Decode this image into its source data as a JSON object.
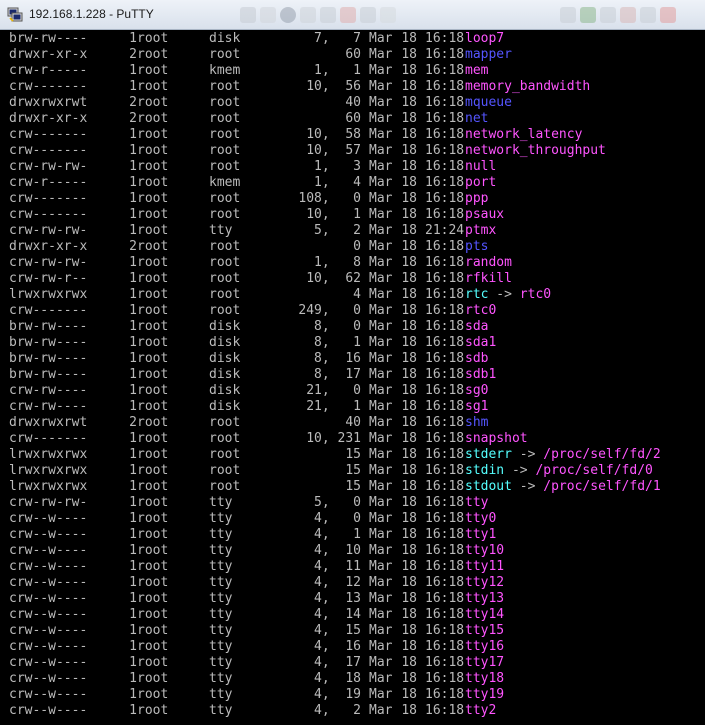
{
  "window": {
    "title": "192.168.1.228 - PuTTY"
  },
  "colors": {
    "background": "#000000",
    "text": "#bbbbbb",
    "directory": "#5555ff",
    "device": "#ff55ff",
    "symlink": "#55ffff"
  },
  "rows": [
    {
      "perm": "brw-rw----",
      "links": "1",
      "owner": "root",
      "group": "disk",
      "size": "7,   7",
      "mon": "Mar",
      "day": "18",
      "time": "16:18",
      "name": "loop7",
      "type": "char",
      "target": "",
      "target_type": ""
    },
    {
      "perm": "drwxr-xr-x",
      "links": "2",
      "owner": "root",
      "group": "root",
      "size": "60",
      "mon": "Mar",
      "day": "18",
      "time": "16:18",
      "name": "mapper",
      "type": "dir",
      "target": "",
      "target_type": ""
    },
    {
      "perm": "crw-r-----",
      "links": "1",
      "owner": "root",
      "group": "kmem",
      "size": "1,   1",
      "mon": "Mar",
      "day": "18",
      "time": "16:18",
      "name": "mem",
      "type": "char",
      "target": "",
      "target_type": ""
    },
    {
      "perm": "crw-------",
      "links": "1",
      "owner": "root",
      "group": "root",
      "size": "10,  56",
      "mon": "Mar",
      "day": "18",
      "time": "16:18",
      "name": "memory_bandwidth",
      "type": "char",
      "target": "",
      "target_type": ""
    },
    {
      "perm": "drwxrwxrwt",
      "links": "2",
      "owner": "root",
      "group": "root",
      "size": "40",
      "mon": "Mar",
      "day": "18",
      "time": "16:18",
      "name": "mqueue",
      "type": "dir",
      "target": "",
      "target_type": ""
    },
    {
      "perm": "drwxr-xr-x",
      "links": "2",
      "owner": "root",
      "group": "root",
      "size": "60",
      "mon": "Mar",
      "day": "18",
      "time": "16:18",
      "name": "net",
      "type": "dir",
      "target": "",
      "target_type": ""
    },
    {
      "perm": "crw-------",
      "links": "1",
      "owner": "root",
      "group": "root",
      "size": "10,  58",
      "mon": "Mar",
      "day": "18",
      "time": "16:18",
      "name": "network_latency",
      "type": "char",
      "target": "",
      "target_type": ""
    },
    {
      "perm": "crw-------",
      "links": "1",
      "owner": "root",
      "group": "root",
      "size": "10,  57",
      "mon": "Mar",
      "day": "18",
      "time": "16:18",
      "name": "network_throughput",
      "type": "char",
      "target": "",
      "target_type": ""
    },
    {
      "perm": "crw-rw-rw-",
      "links": "1",
      "owner": "root",
      "group": "root",
      "size": "1,   3",
      "mon": "Mar",
      "day": "18",
      "time": "16:18",
      "name": "null",
      "type": "char",
      "target": "",
      "target_type": ""
    },
    {
      "perm": "crw-r-----",
      "links": "1",
      "owner": "root",
      "group": "kmem",
      "size": "1,   4",
      "mon": "Mar",
      "day": "18",
      "time": "16:18",
      "name": "port",
      "type": "char",
      "target": "",
      "target_type": ""
    },
    {
      "perm": "crw-------",
      "links": "1",
      "owner": "root",
      "group": "root",
      "size": "108,   0",
      "mon": "Mar",
      "day": "18",
      "time": "16:18",
      "name": "ppp",
      "type": "char",
      "target": "",
      "target_type": ""
    },
    {
      "perm": "crw-------",
      "links": "1",
      "owner": "root",
      "group": "root",
      "size": "10,   1",
      "mon": "Mar",
      "day": "18",
      "time": "16:18",
      "name": "psaux",
      "type": "char",
      "target": "",
      "target_type": ""
    },
    {
      "perm": "crw-rw-rw-",
      "links": "1",
      "owner": "root",
      "group": "tty",
      "size": "5,   2",
      "mon": "Mar",
      "day": "18",
      "time": "21:24",
      "name": "ptmx",
      "type": "char",
      "target": "",
      "target_type": ""
    },
    {
      "perm": "drwxr-xr-x",
      "links": "2",
      "owner": "root",
      "group": "root",
      "size": "0",
      "mon": "Mar",
      "day": "18",
      "time": "16:18",
      "name": "pts",
      "type": "dir",
      "target": "",
      "target_type": ""
    },
    {
      "perm": "crw-rw-rw-",
      "links": "1",
      "owner": "root",
      "group": "root",
      "size": "1,   8",
      "mon": "Mar",
      "day": "18",
      "time": "16:18",
      "name": "random",
      "type": "char",
      "target": "",
      "target_type": ""
    },
    {
      "perm": "crw-rw-r--",
      "links": "1",
      "owner": "root",
      "group": "root",
      "size": "10,  62",
      "mon": "Mar",
      "day": "18",
      "time": "16:18",
      "name": "rfkill",
      "type": "char",
      "target": "",
      "target_type": ""
    },
    {
      "perm": "lrwxrwxrwx",
      "links": "1",
      "owner": "root",
      "group": "root",
      "size": "4",
      "mon": "Mar",
      "day": "18",
      "time": "16:18",
      "name": "rtc",
      "type": "link",
      "target": "rtc0",
      "target_type": "char"
    },
    {
      "perm": "crw-------",
      "links": "1",
      "owner": "root",
      "group": "root",
      "size": "249,   0",
      "mon": "Mar",
      "day": "18",
      "time": "16:18",
      "name": "rtc0",
      "type": "char",
      "target": "",
      "target_type": ""
    },
    {
      "perm": "brw-rw----",
      "links": "1",
      "owner": "root",
      "group": "disk",
      "size": "8,   0",
      "mon": "Mar",
      "day": "18",
      "time": "16:18",
      "name": "sda",
      "type": "char",
      "target": "",
      "target_type": ""
    },
    {
      "perm": "brw-rw----",
      "links": "1",
      "owner": "root",
      "group": "disk",
      "size": "8,   1",
      "mon": "Mar",
      "day": "18",
      "time": "16:18",
      "name": "sda1",
      "type": "char",
      "target": "",
      "target_type": ""
    },
    {
      "perm": "brw-rw----",
      "links": "1",
      "owner": "root",
      "group": "disk",
      "size": "8,  16",
      "mon": "Mar",
      "day": "18",
      "time": "16:18",
      "name": "sdb",
      "type": "char",
      "target": "",
      "target_type": ""
    },
    {
      "perm": "brw-rw----",
      "links": "1",
      "owner": "root",
      "group": "disk",
      "size": "8,  17",
      "mon": "Mar",
      "day": "18",
      "time": "16:18",
      "name": "sdb1",
      "type": "char",
      "target": "",
      "target_type": ""
    },
    {
      "perm": "crw-rw----",
      "links": "1",
      "owner": "root",
      "group": "disk",
      "size": "21,   0",
      "mon": "Mar",
      "day": "18",
      "time": "16:18",
      "name": "sg0",
      "type": "char",
      "target": "",
      "target_type": ""
    },
    {
      "perm": "crw-rw----",
      "links": "1",
      "owner": "root",
      "group": "disk",
      "size": "21,   1",
      "mon": "Mar",
      "day": "18",
      "time": "16:18",
      "name": "sg1",
      "type": "char",
      "target": "",
      "target_type": ""
    },
    {
      "perm": "drwxrwxrwt",
      "links": "2",
      "owner": "root",
      "group": "root",
      "size": "40",
      "mon": "Mar",
      "day": "18",
      "time": "16:18",
      "name": "shm",
      "type": "dir",
      "target": "",
      "target_type": ""
    },
    {
      "perm": "crw-------",
      "links": "1",
      "owner": "root",
      "group": "root",
      "size": "10, 231",
      "mon": "Mar",
      "day": "18",
      "time": "16:18",
      "name": "snapshot",
      "type": "char",
      "target": "",
      "target_type": ""
    },
    {
      "perm": "lrwxrwxrwx",
      "links": "1",
      "owner": "root",
      "group": "root",
      "size": "15",
      "mon": "Mar",
      "day": "18",
      "time": "16:18",
      "name": "stderr",
      "type": "link",
      "target": "/proc/self/fd/2",
      "target_type": "char"
    },
    {
      "perm": "lrwxrwxrwx",
      "links": "1",
      "owner": "root",
      "group": "root",
      "size": "15",
      "mon": "Mar",
      "day": "18",
      "time": "16:18",
      "name": "stdin",
      "type": "link",
      "target": "/proc/self/fd/0",
      "target_type": "char"
    },
    {
      "perm": "lrwxrwxrwx",
      "links": "1",
      "owner": "root",
      "group": "root",
      "size": "15",
      "mon": "Mar",
      "day": "18",
      "time": "16:18",
      "name": "stdout",
      "type": "link",
      "target": "/proc/self/fd/1",
      "target_type": "char"
    },
    {
      "perm": "crw-rw-rw-",
      "links": "1",
      "owner": "root",
      "group": "tty",
      "size": "5,   0",
      "mon": "Mar",
      "day": "18",
      "time": "16:18",
      "name": "tty",
      "type": "char",
      "target": "",
      "target_type": ""
    },
    {
      "perm": "crw--w----",
      "links": "1",
      "owner": "root",
      "group": "tty",
      "size": "4,   0",
      "mon": "Mar",
      "day": "18",
      "time": "16:18",
      "name": "tty0",
      "type": "char",
      "target": "",
      "target_type": ""
    },
    {
      "perm": "crw--w----",
      "links": "1",
      "owner": "root",
      "group": "tty",
      "size": "4,   1",
      "mon": "Mar",
      "day": "18",
      "time": "16:18",
      "name": "tty1",
      "type": "char",
      "target": "",
      "target_type": ""
    },
    {
      "perm": "crw--w----",
      "links": "1",
      "owner": "root",
      "group": "tty",
      "size": "4,  10",
      "mon": "Mar",
      "day": "18",
      "time": "16:18",
      "name": "tty10",
      "type": "char",
      "target": "",
      "target_type": ""
    },
    {
      "perm": "crw--w----",
      "links": "1",
      "owner": "root",
      "group": "tty",
      "size": "4,  11",
      "mon": "Mar",
      "day": "18",
      "time": "16:18",
      "name": "tty11",
      "type": "char",
      "target": "",
      "target_type": ""
    },
    {
      "perm": "crw--w----",
      "links": "1",
      "owner": "root",
      "group": "tty",
      "size": "4,  12",
      "mon": "Mar",
      "day": "18",
      "time": "16:18",
      "name": "tty12",
      "type": "char",
      "target": "",
      "target_type": ""
    },
    {
      "perm": "crw--w----",
      "links": "1",
      "owner": "root",
      "group": "tty",
      "size": "4,  13",
      "mon": "Mar",
      "day": "18",
      "time": "16:18",
      "name": "tty13",
      "type": "char",
      "target": "",
      "target_type": ""
    },
    {
      "perm": "crw--w----",
      "links": "1",
      "owner": "root",
      "group": "tty",
      "size": "4,  14",
      "mon": "Mar",
      "day": "18",
      "time": "16:18",
      "name": "tty14",
      "type": "char",
      "target": "",
      "target_type": ""
    },
    {
      "perm": "crw--w----",
      "links": "1",
      "owner": "root",
      "group": "tty",
      "size": "4,  15",
      "mon": "Mar",
      "day": "18",
      "time": "16:18",
      "name": "tty15",
      "type": "char",
      "target": "",
      "target_type": ""
    },
    {
      "perm": "crw--w----",
      "links": "1",
      "owner": "root",
      "group": "tty",
      "size": "4,  16",
      "mon": "Mar",
      "day": "18",
      "time": "16:18",
      "name": "tty16",
      "type": "char",
      "target": "",
      "target_type": ""
    },
    {
      "perm": "crw--w----",
      "links": "1",
      "owner": "root",
      "group": "tty",
      "size": "4,  17",
      "mon": "Mar",
      "day": "18",
      "time": "16:18",
      "name": "tty17",
      "type": "char",
      "target": "",
      "target_type": ""
    },
    {
      "perm": "crw--w----",
      "links": "1",
      "owner": "root",
      "group": "tty",
      "size": "4,  18",
      "mon": "Mar",
      "day": "18",
      "time": "16:18",
      "name": "tty18",
      "type": "char",
      "target": "",
      "target_type": ""
    },
    {
      "perm": "crw--w----",
      "links": "1",
      "owner": "root",
      "group": "tty",
      "size": "4,  19",
      "mon": "Mar",
      "day": "18",
      "time": "16:18",
      "name": "tty19",
      "type": "char",
      "target": "",
      "target_type": ""
    },
    {
      "perm": "crw--w----",
      "links": "1",
      "owner": "root",
      "group": "tty",
      "size": "4,   2",
      "mon": "Mar",
      "day": "18",
      "time": "16:18",
      "name": "tty2",
      "type": "char",
      "target": "",
      "target_type": ""
    }
  ]
}
